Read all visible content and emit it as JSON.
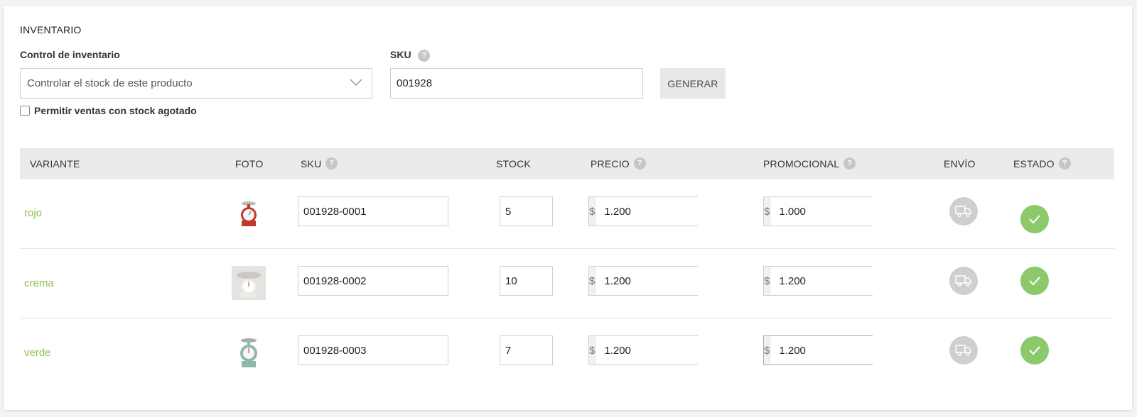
{
  "section_title": "INVENTARIO",
  "inventory_control": {
    "label": "Control de inventario",
    "selected": "Controlar el stock de este producto"
  },
  "sku": {
    "label": "SKU",
    "help": "?",
    "value": "001928",
    "generate_label": "GENERAR"
  },
  "allow_backorder": {
    "label": "Permitir ventas con stock agotado",
    "checked": false
  },
  "table": {
    "headers": {
      "variant": "VARIANTE",
      "photo": "FOTO",
      "sku": "SKU",
      "stock": "STOCK",
      "price": "PRECIO",
      "promo": "PROMOCIONAL",
      "shipping": "ENVÍO",
      "status": "ESTADO"
    },
    "help": "?",
    "currency": "$",
    "rows": [
      {
        "variant": "rojo",
        "photo": "red-scale-photo",
        "sku": "001928-0001",
        "stock": "5",
        "price": "1.200",
        "promo": "1.000",
        "shipping_icon": "truck-icon",
        "status_icon": "check-icon"
      },
      {
        "variant": "crema",
        "photo": "cream-scale-photo",
        "sku": "001928-0002",
        "stock": "10",
        "price": "1.200",
        "promo": "1.200",
        "shipping_icon": "truck-icon",
        "status_icon": "check-icon"
      },
      {
        "variant": "verde",
        "photo": "green-scale-photo",
        "sku": "001928-0003",
        "stock": "7",
        "price": "1.200",
        "promo": "1.200",
        "shipping_icon": "truck-icon",
        "status_icon": "check-icon"
      }
    ]
  },
  "colors": {
    "variant_text": "#8cc04b",
    "status_active": "#8cc96b",
    "shipping_inactive": "#cfcfcf",
    "header_bg": "#ebebeb"
  }
}
